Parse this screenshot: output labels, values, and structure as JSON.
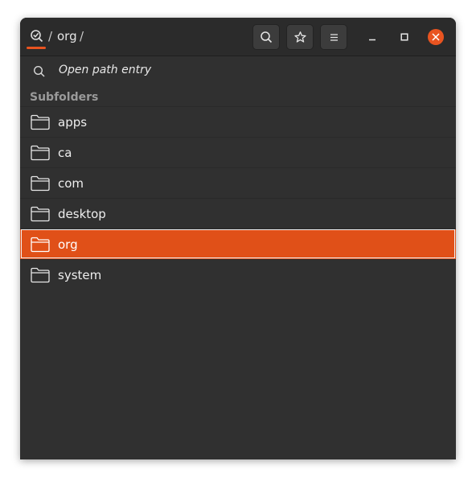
{
  "header": {
    "root_icon": "folder-search-icon",
    "separator": "/",
    "current": "org",
    "buttons": [
      {
        "name": "search-button",
        "icon": "search-icon"
      },
      {
        "name": "bookmark-button",
        "icon": "star-icon"
      },
      {
        "name": "menu-button",
        "icon": "hamburger-icon"
      }
    ],
    "window_controls": [
      "minimize-icon",
      "maximize-icon",
      "close-icon"
    ],
    "accent": "#e95420"
  },
  "path_entry": {
    "icon": "search-icon",
    "label": "Open path entry"
  },
  "subfolders": {
    "title": "Subfolders",
    "items": [
      {
        "label": "apps",
        "selected": false
      },
      {
        "label": "ca",
        "selected": false
      },
      {
        "label": "com",
        "selected": false
      },
      {
        "label": "desktop",
        "selected": false
      },
      {
        "label": "org",
        "selected": true
      },
      {
        "label": "system",
        "selected": false
      }
    ],
    "selection_color": "#e05018"
  }
}
